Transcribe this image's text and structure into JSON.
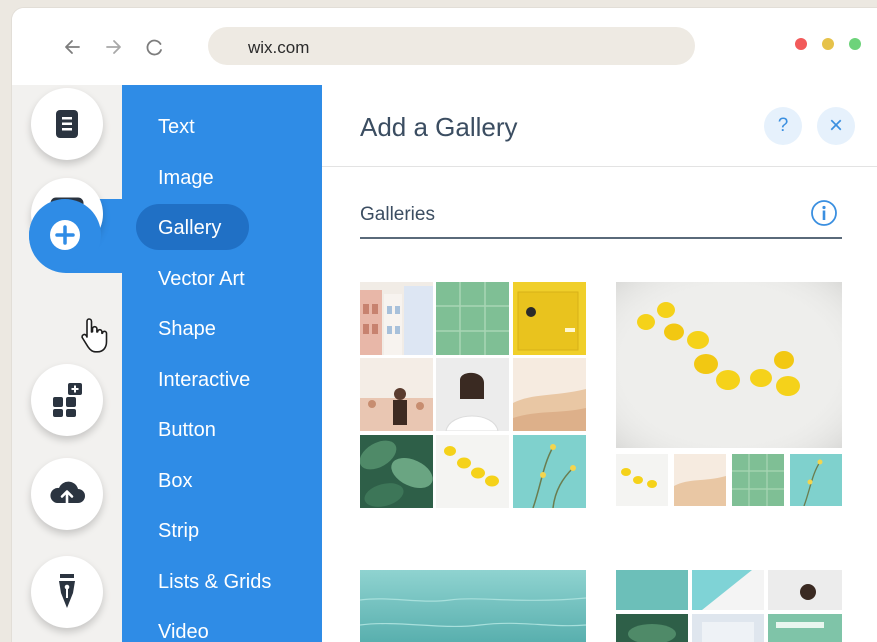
{
  "browser": {
    "url": "wix.com",
    "back_icon": "arrow-left-icon",
    "forward_icon": "arrow-right-icon",
    "reload_icon": "reload-icon",
    "window_dots": [
      "#f25a5a",
      "#e6c24a",
      "#6dd37a"
    ]
  },
  "rail": {
    "tools": [
      {
        "name": "pages-icon"
      },
      {
        "name": "background-icon"
      },
      {
        "name": "add-icon",
        "active": true
      },
      {
        "name": "apps-icon"
      },
      {
        "name": "upload-icon"
      },
      {
        "name": "blog-pen-icon"
      }
    ]
  },
  "menu": {
    "items": [
      "Text",
      "Image",
      "Gallery",
      "Vector Art",
      "Shape",
      "Interactive",
      "Button",
      "Box",
      "Strip",
      "Lists & Grids",
      "Video"
    ],
    "selected": "Gallery"
  },
  "panel": {
    "title": "Add a Gallery",
    "help_label": "?",
    "close_label": "×",
    "section_title": "Galleries"
  },
  "colors": {
    "accent": "#2f8ce6",
    "accent_dark": "#2070c5",
    "title": "#3b4d61"
  }
}
